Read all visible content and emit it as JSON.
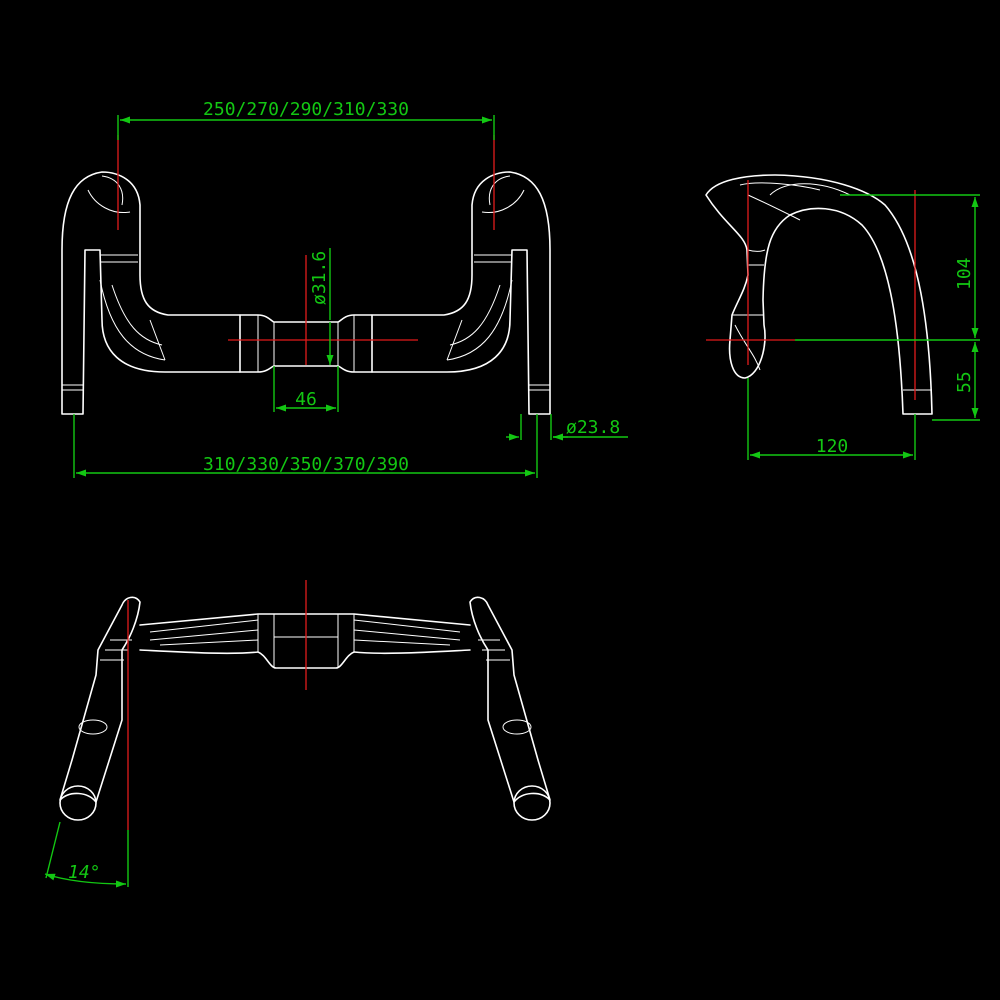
{
  "dimensions": {
    "top_width": "250/270/290/310/330",
    "bottom_width": "310/330/350/370/390",
    "clamp_diameter": "ø31.6",
    "clamp_length": "46",
    "end_diameter": "ø23.8",
    "drop": "104",
    "lower_drop": "55",
    "reach": "120",
    "flare_angle": "14°"
  },
  "colors": {
    "background": "#000000",
    "outline": "#ffffff",
    "dimension": "#13c713",
    "centerline": "#e21b1b"
  }
}
